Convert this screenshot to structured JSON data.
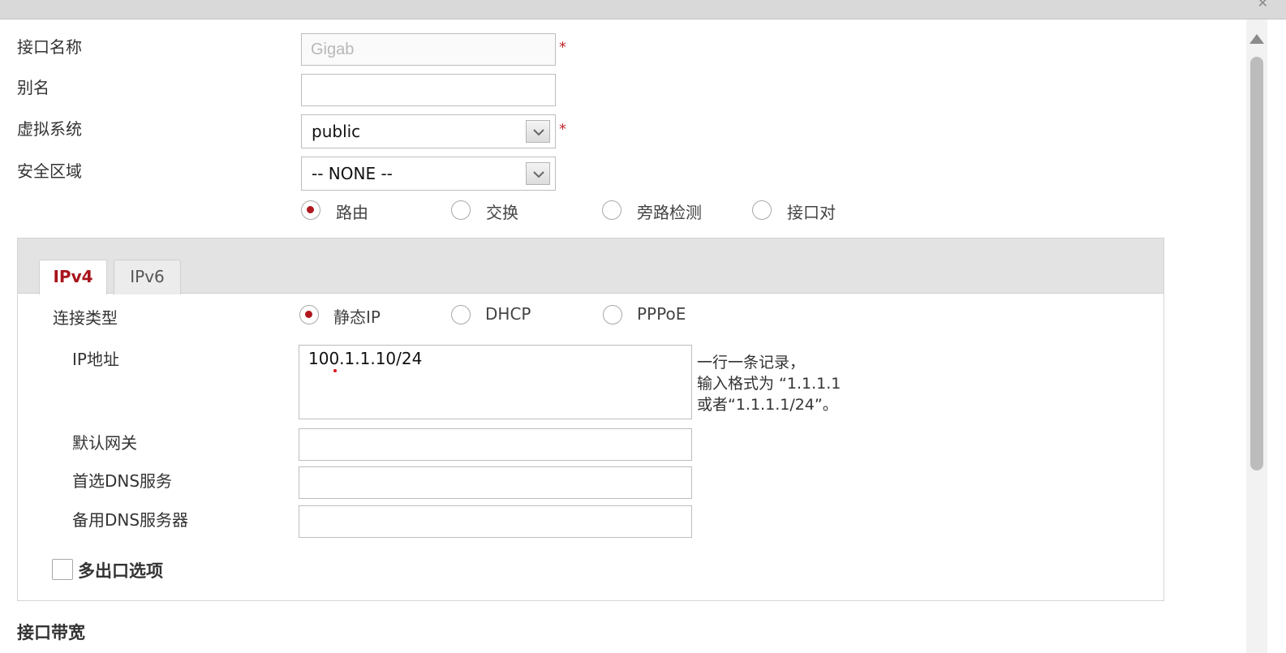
{
  "form": {
    "interface_name_label": "接口名称",
    "interface_name_value": "Gigab",
    "alias_label": "别名",
    "alias_value": "",
    "vsys_label": "虚拟系统",
    "vsys_value": "public",
    "zone_label": "安全区域",
    "zone_value": "-- NONE --",
    "required_mark": "*",
    "mode_options": [
      "路由",
      "交换",
      "旁路检测",
      "接口对"
    ],
    "mode_selected": "路由"
  },
  "ip_panel": {
    "tabs": [
      "IPv4",
      "IPv6"
    ],
    "active_tab": "IPv4",
    "conn_type_label": "连接类型",
    "conn_options": [
      "静态IP",
      "DHCP",
      "PPPoE"
    ],
    "conn_selected": "静态IP",
    "ip_label": "IP地址",
    "ip_value": "100.1.1.10/24",
    "ip_hint": [
      "一行一条记录，",
      "输入格式为 “1.1.1.1",
      "或者“1.1.1.1/24”。"
    ],
    "gateway_label": "默认网关",
    "gateway_value": "",
    "dns1_label": "首选DNS服务",
    "dns1_value": "",
    "dns2_label": "备用DNS服务器",
    "dns2_value": "",
    "multi_exit_label": "多出口选项",
    "multi_exit_checked": false
  },
  "bandwidth_label": "接口带宽",
  "colors": {
    "accent": "#a8141b",
    "panel_header": "#e3e3e3",
    "border": "#bdbdbd"
  },
  "icons": {
    "dropdown": "chevron-down-icon",
    "scroll_up": "triangle-up-icon",
    "close": "close-icon"
  }
}
